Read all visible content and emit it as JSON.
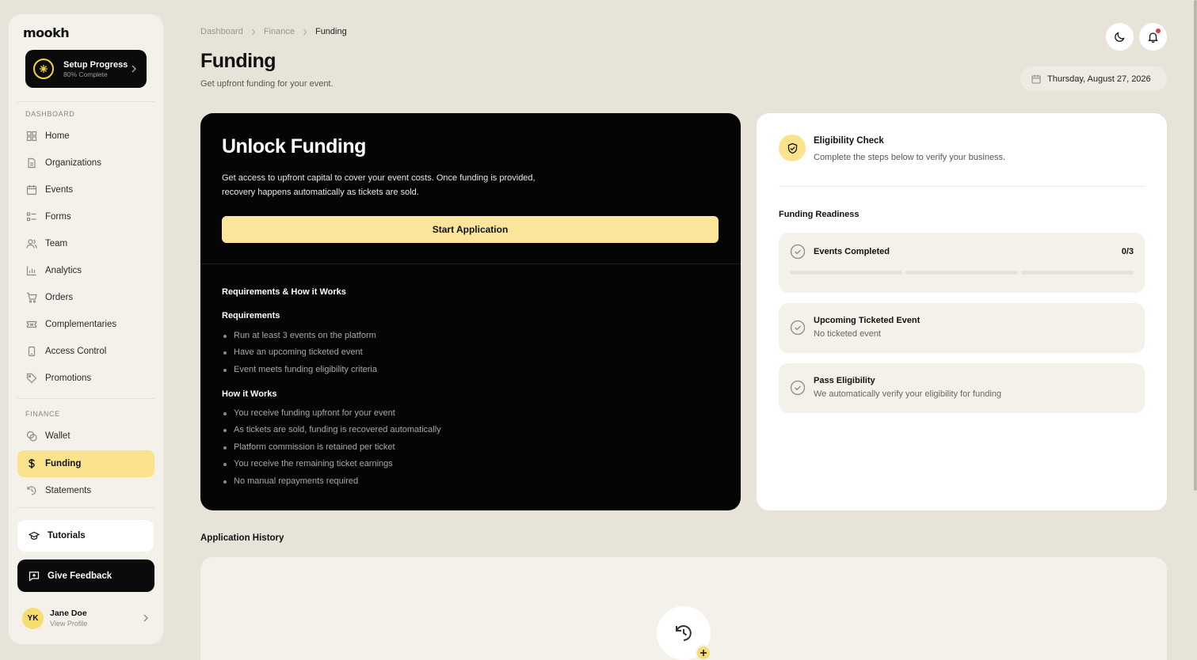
{
  "brand": {
    "logo_text": "mookh"
  },
  "setup": {
    "title": "Setup Progress",
    "subtitle": "80% Complete"
  },
  "sidebar": {
    "dashboard_label": "DASHBOARD",
    "finance_label": "FINANCE",
    "items": [
      {
        "label": "Home",
        "icon": "grid-icon"
      },
      {
        "label": "Organizations",
        "icon": "document-icon"
      },
      {
        "label": "Events",
        "icon": "calendar-icon"
      },
      {
        "label": "Forms",
        "icon": "list-icon"
      },
      {
        "label": "Team",
        "icon": "users-icon"
      },
      {
        "label": "Analytics",
        "icon": "bar-chart-icon"
      },
      {
        "label": "Orders",
        "icon": "cart-icon"
      },
      {
        "label": "Complementaries",
        "icon": "ticket-icon"
      },
      {
        "label": "Access Control",
        "icon": "phone-icon"
      },
      {
        "label": "Promotions",
        "icon": "tag-icon"
      }
    ],
    "finance_items": [
      {
        "label": "Wallet",
        "icon": "coins-icon"
      },
      {
        "label": "Funding",
        "icon": "dollar-icon",
        "active": true
      },
      {
        "label": "Statements",
        "icon": "history-icon"
      }
    ],
    "tutorials_label": "Tutorials",
    "feedback_label": "Give Feedback",
    "profile": {
      "initials": "YK",
      "name": "Jane Doe",
      "link": "View Profile"
    }
  },
  "header": {
    "breadcrumb": [
      "Dashboard",
      "Finance",
      "Funding"
    ],
    "title": "Funding",
    "subtitle": "Get upfront funding for your event.",
    "date": "Thursday, August 27, 2026"
  },
  "unlock": {
    "title": "Unlock Funding",
    "description": "Get access to upfront capital to cover your event costs. Once funding is provided, recovery happens automatically as tickets are sold.",
    "button": "Start Application",
    "section_title": "Requirements & How it Works",
    "requirements_title": "Requirements",
    "requirements": [
      "Run at least 3 events on the platform",
      "Have an upcoming ticketed event",
      "Event meets funding eligibility criteria"
    ],
    "how_title": "How it Works",
    "how": [
      "You receive funding upfront for your event",
      "As tickets are sold, funding is recovered automatically",
      "Platform commission is retained per ticket",
      "You receive the remaining ticket earnings",
      "No manual repayments required"
    ]
  },
  "eligibility": {
    "title": "Eligibility Check",
    "subtitle": "Complete the steps below to verify your business.",
    "readiness_title": "Funding Readiness",
    "checks": [
      {
        "title": "Events Completed",
        "count": "0/3",
        "progress": 0
      },
      {
        "title": "Upcoming Ticketed Event",
        "subtitle": "No ticketed event"
      },
      {
        "title": "Pass Eligibility",
        "subtitle": "We automatically verify your eligibility for funding"
      }
    ]
  },
  "history": {
    "title": "Application History"
  },
  "colors": {
    "accent": "#fbe28c",
    "background": "#e8e3d8",
    "dark": "#050505"
  }
}
